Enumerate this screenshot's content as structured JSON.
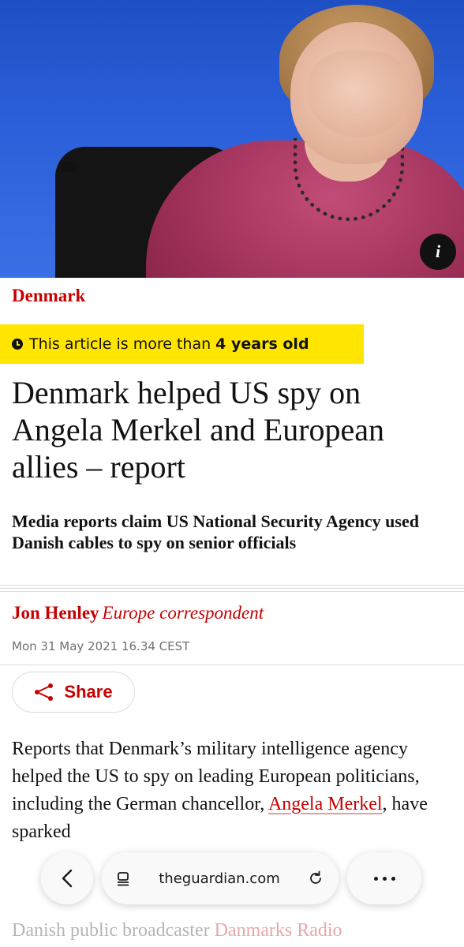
{
  "article": {
    "section": "Denmark",
    "age_notice_prefix": "This article is more than",
    "age_notice_bold": "4 years old",
    "headline": "Denmark helped US spy on Angela Merkel and European allies – report",
    "standfirst": "Media reports claim US National Security Agency used Danish cables to spy on senior officials",
    "author": "Jon Henley",
    "author_role": "Europe correspondent",
    "date": "Mon 31 May 2021 16.34 CEST",
    "share_label": "Share",
    "body_p1_before": "Reports that Denmark’s military intelligence agency helped the US to spy on leading European politicians, including the German chancellor, ",
    "body_p1_link": "Angela Merkel",
    "body_p1_after": ", have sparked",
    "body_p2_before": "Danish public broadcaster ",
    "body_p2_link": "Danmarks Radio",
    "info_label": "i"
  },
  "browser": {
    "url": "theguardian.com"
  },
  "colors": {
    "accent": "#c70000",
    "age_banner": "#ffe500"
  }
}
